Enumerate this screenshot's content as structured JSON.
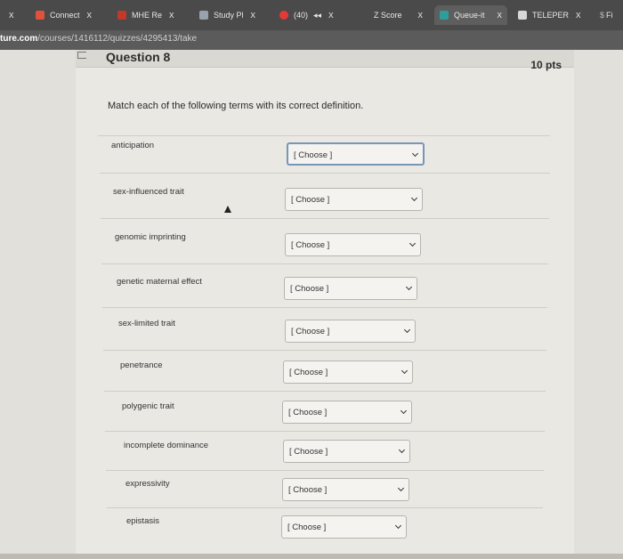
{
  "browser": {
    "tabs": [
      {
        "label": "Connect",
        "icon": "connect-icon",
        "color": "#e0533a"
      },
      {
        "label": "MHE Re",
        "icon": "mhe-icon",
        "color": "#c0392b"
      },
      {
        "label": "Study Pl",
        "icon": "study-icon",
        "color": "#9aa3ad"
      },
      {
        "label": "(40)",
        "icon": "youtube-icon",
        "color": "#e53935"
      },
      {
        "label": "Z Score",
        "icon": "page-icon",
        "color": "#9e9e9e"
      },
      {
        "label": "Queue-it",
        "icon": "queue-icon",
        "color": "#2f9e9a"
      },
      {
        "label": "TELEPER",
        "icon": "tele-icon",
        "color": "#d7d7d7"
      },
      {
        "label": "Fi",
        "icon": "fi-icon",
        "color": "#aaaaaa"
      }
    ],
    "close_glyph": "x",
    "url_host": "ture.com",
    "url_path": "/courses/1416112/quizzes/4295413/take"
  },
  "question": {
    "title": "Question 8",
    "points": "10 pts",
    "instruction": "Match each of the following terms with its correct definition."
  },
  "items": [
    {
      "term": "anticipation",
      "selected": "[ Choose ]"
    },
    {
      "term": "sex-influenced trait",
      "selected": "[ Choose ]"
    },
    {
      "term": "genomic imprinting",
      "selected": "[ Choose ]"
    },
    {
      "term": "genetic maternal effect",
      "selected": "[ Choose ]"
    },
    {
      "term": "sex-limited trait",
      "selected": "[ Choose ]"
    },
    {
      "term": "penetrance",
      "selected": "[ Choose ]"
    },
    {
      "term": "polygenic trait",
      "selected": "[ Choose ]"
    },
    {
      "term": "incomplete dominance",
      "selected": "[ Choose ]"
    },
    {
      "term": "expressivity",
      "selected": "[ Choose ]"
    },
    {
      "term": "epistasis",
      "selected": "[ Choose ]"
    }
  ]
}
